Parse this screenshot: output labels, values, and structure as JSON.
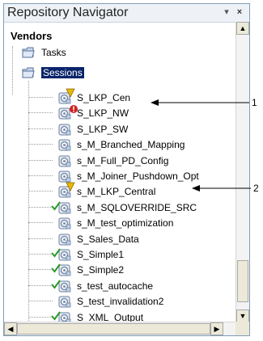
{
  "panel": {
    "title": "Repository Navigator"
  },
  "tree": {
    "root": "Vendors",
    "folders": [
      {
        "label": "Tasks"
      },
      {
        "label": "Sessions"
      }
    ],
    "sessions": [
      {
        "label": "S_LKP_Cen",
        "status": "warning"
      },
      {
        "label": "S_LKP_NW",
        "status": "error"
      },
      {
        "label": "S_LKP_SW",
        "status": "none"
      },
      {
        "label": "s_M_Branched_Mapping",
        "status": "none"
      },
      {
        "label": "s_M_Full_PD_Config",
        "status": "none"
      },
      {
        "label": "s_M_Joiner_Pushdown_Opt",
        "status": "none"
      },
      {
        "label": "s_M_LKP_Central",
        "status": "warning"
      },
      {
        "label": "s_M_SQLOVERRIDE_SRC",
        "status": "valid"
      },
      {
        "label": "s_M_test_optimization",
        "status": "none"
      },
      {
        "label": "S_Sales_Data",
        "status": "none"
      },
      {
        "label": "S_Simple1",
        "status": "valid"
      },
      {
        "label": "S_Simple2",
        "status": "valid"
      },
      {
        "label": "s_test_autocache",
        "status": "valid"
      },
      {
        "label": "S_test_invalidation2",
        "status": "none"
      },
      {
        "label": "S_XML_Output",
        "status": "valid"
      }
    ]
  },
  "callouts": [
    "1",
    "2"
  ],
  "colors": {
    "selection": "#0a246a",
    "folder": "#c8d8f0",
    "warning": "#e8b800",
    "error": "#d42020",
    "valid": "#2a9a2a"
  }
}
